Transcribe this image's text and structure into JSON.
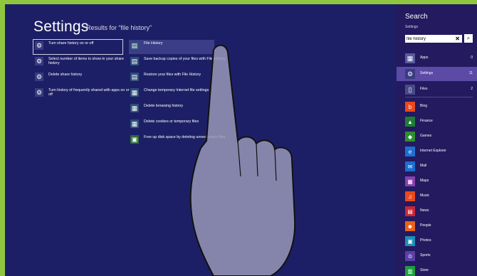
{
  "header": {
    "title": "Settings",
    "subtitle": "Results for “file history”"
  },
  "results_left": [
    {
      "label": "Turn share history on or off",
      "icon": "gear-icon"
    },
    {
      "label": "Select number of items to show in your share history",
      "icon": "gear-icon"
    },
    {
      "label": "Delete share history",
      "icon": "gear-icon"
    },
    {
      "label": "Turn history of frequently shared with apps on or off",
      "icon": "gear-icon"
    }
  ],
  "results_right": [
    {
      "label": "File History",
      "icon": "file-history-icon"
    },
    {
      "label": "Save backup copies of your files with File History",
      "icon": "file-history-icon"
    },
    {
      "label": "Restore your files with File History",
      "icon": "file-history-icon"
    },
    {
      "label": "Change temporary Internet file settings",
      "icon": "internet-settings-icon"
    },
    {
      "label": "Delete browsing history",
      "icon": "internet-settings-icon"
    },
    {
      "label": "Delete cookies or temporary files",
      "icon": "internet-settings-icon"
    },
    {
      "label": "Free up disk space by deleting unnecessary files",
      "icon": "disk-cleanup-icon"
    }
  ],
  "charm": {
    "title": "Search",
    "scope": "Settings",
    "query": "file history",
    "categories": [
      {
        "label": "Apps",
        "count": "0",
        "icon": "apps-icon",
        "color": "#5a5aa0"
      },
      {
        "label": "Settings",
        "count": "11",
        "icon": "gear-icon",
        "color": "#3a3c82"
      },
      {
        "label": "Files",
        "count": "2",
        "icon": "files-icon",
        "color": "#4a4a8a"
      }
    ],
    "apps": [
      {
        "label": "Bing",
        "icon": "bing-icon",
        "color": "#e8491d"
      },
      {
        "label": "Finance",
        "icon": "finance-icon",
        "color": "#1e7e34"
      },
      {
        "label": "Games",
        "icon": "games-icon",
        "color": "#2f8f2f"
      },
      {
        "label": "Internet Explorer",
        "icon": "internet-explorer-icon",
        "color": "#1f6fd1"
      },
      {
        "label": "Mail",
        "icon": "mail-icon",
        "color": "#1c6fcf"
      },
      {
        "label": "Maps",
        "icon": "maps-icon",
        "color": "#8a3fb0"
      },
      {
        "label": "Music",
        "icon": "music-icon",
        "color": "#e8491d"
      },
      {
        "label": "News",
        "icon": "news-icon",
        "color": "#c9263a"
      },
      {
        "label": "People",
        "icon": "people-icon",
        "color": "#e8621d"
      },
      {
        "label": "Photos",
        "icon": "photos-icon",
        "color": "#1c8fb8"
      },
      {
        "label": "Sports",
        "icon": "sports-icon",
        "color": "#5b3fa6"
      },
      {
        "label": "Store",
        "icon": "store-icon",
        "color": "#1f9f3f"
      }
    ]
  }
}
